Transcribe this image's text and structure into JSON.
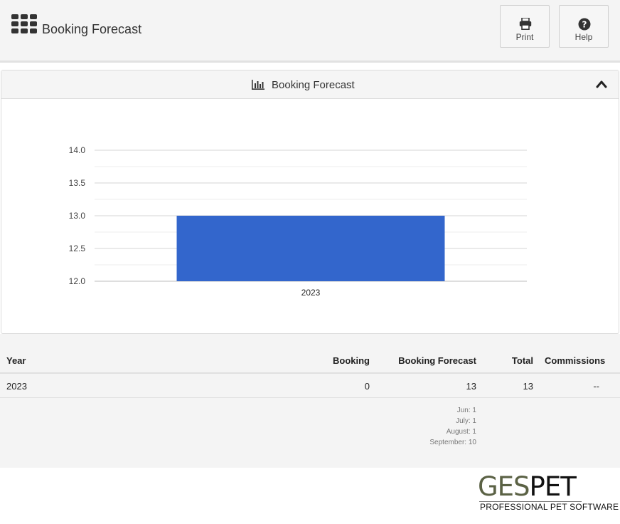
{
  "header": {
    "title": "Booking Forecast",
    "buttons": {
      "print": "Print",
      "help": "Help"
    }
  },
  "panel": {
    "title": "Booking Forecast"
  },
  "chart_data": {
    "type": "bar",
    "categories": [
      "2023"
    ],
    "values": [
      13
    ],
    "ylim": [
      12,
      14
    ],
    "yticks": [
      "14.0",
      "13.5",
      "13.0",
      "12.5",
      "12.0"
    ],
    "grid": true,
    "bar_color": "#3366cc"
  },
  "table": {
    "columns": [
      "Year",
      "Booking",
      "Booking Forecast",
      "Total",
      "Commissions"
    ],
    "rows": [
      {
        "year": "2023",
        "booking": "0",
        "forecast": "13",
        "total": "13",
        "commissions": "--"
      }
    ],
    "breakdown": [
      "Jun: 1",
      "July: 1",
      "August: 1",
      "September: 10"
    ]
  },
  "logo": {
    "part1": "GES",
    "part2": "PET",
    "tagline1": "PROFESSIONAL",
    "tagline2": " PET SOFTWARE"
  },
  "colors": {
    "accent": "#3366cc",
    "header_bg": "#f4f4f4"
  }
}
